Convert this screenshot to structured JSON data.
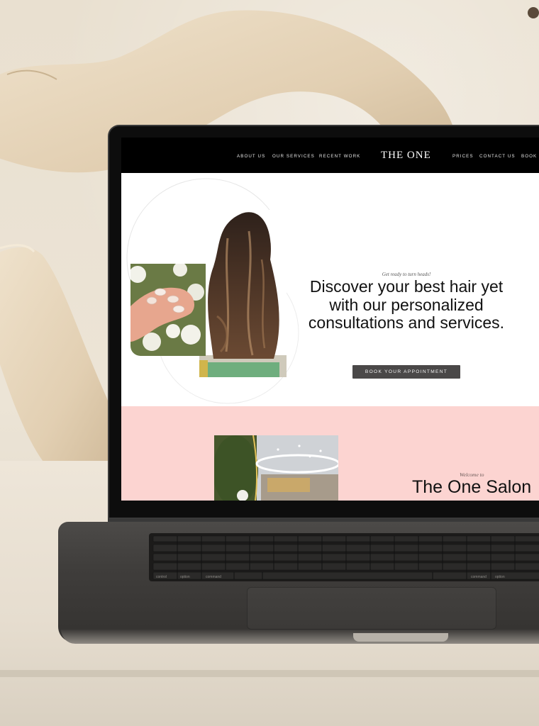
{
  "nav": {
    "links_left": [
      "ABOUT US",
      "OUR SERVICES",
      "RECENT WORK"
    ],
    "brand": "THE ONE",
    "links_right": [
      "PRICES",
      "CONTACT US",
      "BOOK"
    ]
  },
  "hero": {
    "eyebrow": "Get ready to turn heads!",
    "headline": "Discover your best hair yet with our personalized consultations and services.",
    "cta_label": "BOOK YOUR APPOINTMENT"
  },
  "welcome": {
    "eyebrow": "Welcome to",
    "title": "The One Salon"
  },
  "keyboard": {
    "key_labels": [
      "control",
      "option",
      "command",
      "command",
      "option"
    ]
  },
  "colors": {
    "nav_bg": "#000000",
    "cta_bg": "#4a4848",
    "pink_section": "#fcd4d1",
    "wall": "#e9e0d0"
  }
}
